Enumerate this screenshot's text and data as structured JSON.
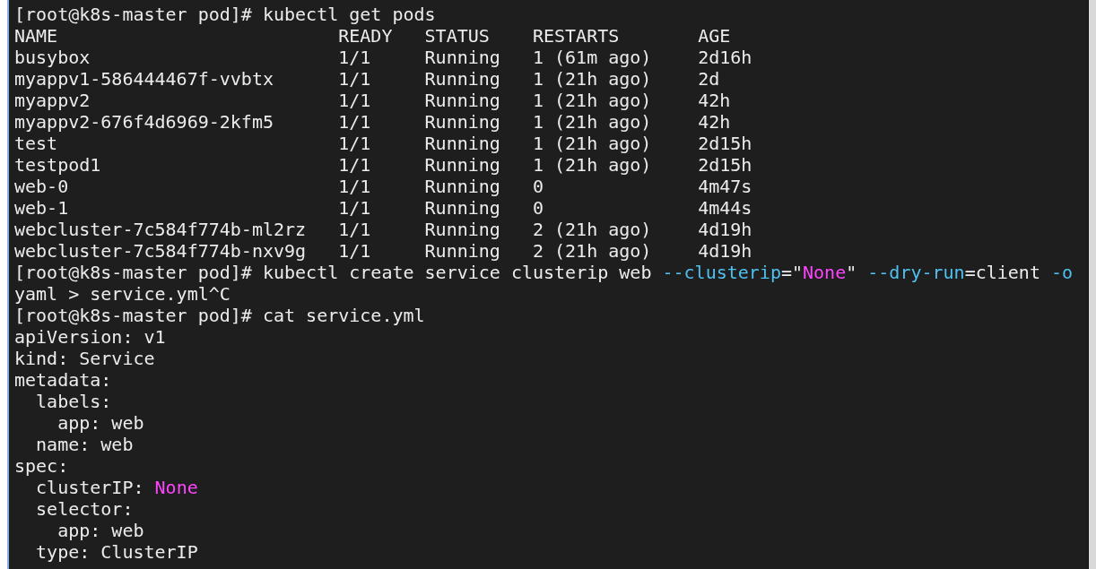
{
  "terminal": {
    "entries": [
      {
        "kind": "command",
        "segments": [
          {
            "kind": "plain",
            "text": "[root@k8s-master pod]# kubectl get pods"
          }
        ]
      },
      {
        "kind": "table",
        "columns": [
          "NAME",
          "READY",
          "STATUS",
          "RESTARTS",
          "AGE"
        ],
        "rows": [
          [
            "busybox",
            "1/1",
            "Running",
            "1 (61m ago)",
            "2d16h"
          ],
          [
            "myappv1-586444467f-vvbtx",
            "1/1",
            "Running",
            "1 (21h ago)",
            "2d"
          ],
          [
            "myappv2",
            "1/1",
            "Running",
            "1 (21h ago)",
            "42h"
          ],
          [
            "myappv2-676f4d6969-2kfm5",
            "1/1",
            "Running",
            "1 (21h ago)",
            "42h"
          ],
          [
            "test",
            "1/1",
            "Running",
            "1 (21h ago)",
            "2d15h"
          ],
          [
            "testpod1",
            "1/1",
            "Running",
            "1 (21h ago)",
            "2d15h"
          ],
          [
            "web-0",
            "1/1",
            "Running",
            "0",
            "4m47s"
          ],
          [
            "web-1",
            "1/1",
            "Running",
            "0",
            "4m44s"
          ],
          [
            "webcluster-7c584f774b-ml2rz",
            "1/1",
            "Running",
            "2 (21h ago)",
            "4d19h"
          ],
          [
            "webcluster-7c584f774b-nxv9g",
            "1/1",
            "Running",
            "2 (21h ago)",
            "4d19h"
          ]
        ]
      },
      {
        "kind": "command",
        "segments": [
          {
            "kind": "plain",
            "text": "[root@k8s-master pod]# kubectl create service clusterip web "
          },
          {
            "kind": "flag",
            "text": "--clusterip"
          },
          {
            "kind": "plain",
            "text": "=\""
          },
          {
            "kind": "string",
            "text": "None"
          },
          {
            "kind": "plain",
            "text": "\" "
          },
          {
            "kind": "flag",
            "text": "--dry-run"
          },
          {
            "kind": "plain",
            "text": "=client "
          },
          {
            "kind": "flag",
            "text": "-o"
          }
        ]
      },
      {
        "kind": "command",
        "segments": [
          {
            "kind": "plain",
            "text": "yaml > service.yml^C"
          }
        ]
      },
      {
        "kind": "command",
        "segments": [
          {
            "kind": "plain",
            "text": "[root@k8s-master pod]# cat service.yml"
          }
        ]
      },
      {
        "kind": "output",
        "segments": [
          {
            "kind": "plain",
            "text": "apiVersion: v1"
          }
        ]
      },
      {
        "kind": "output",
        "segments": [
          {
            "kind": "plain",
            "text": "kind: Service"
          }
        ]
      },
      {
        "kind": "output",
        "segments": [
          {
            "kind": "plain",
            "text": "metadata:"
          }
        ]
      },
      {
        "kind": "output",
        "segments": [
          {
            "kind": "plain",
            "text": "  labels:"
          }
        ]
      },
      {
        "kind": "output",
        "segments": [
          {
            "kind": "plain",
            "text": "    app: web"
          }
        ]
      },
      {
        "kind": "output",
        "segments": [
          {
            "kind": "plain",
            "text": "  name: web"
          }
        ]
      },
      {
        "kind": "output",
        "segments": [
          {
            "kind": "plain",
            "text": "spec:"
          }
        ]
      },
      {
        "kind": "output",
        "segments": [
          {
            "kind": "plain",
            "text": "  clusterIP: "
          },
          {
            "kind": "string",
            "text": "None"
          }
        ]
      },
      {
        "kind": "output",
        "segments": [
          {
            "kind": "plain",
            "text": "  selector:"
          }
        ]
      },
      {
        "kind": "output",
        "segments": [
          {
            "kind": "plain",
            "text": "    app: web"
          }
        ]
      },
      {
        "kind": "output",
        "segments": [
          {
            "kind": "plain",
            "text": "  type: ClusterIP"
          }
        ]
      }
    ]
  }
}
